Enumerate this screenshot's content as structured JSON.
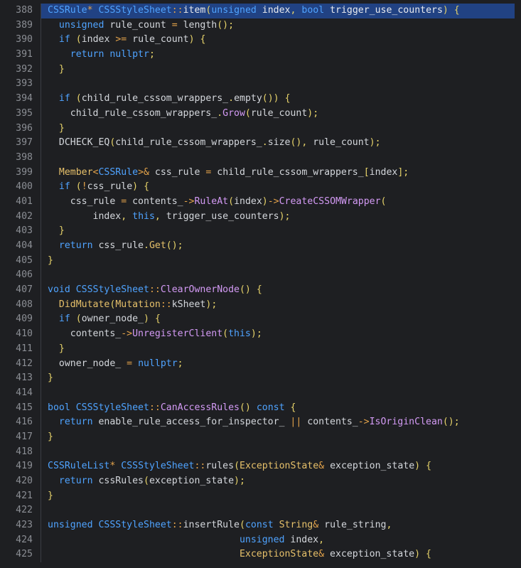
{
  "editor": {
    "lines": [
      {
        "n": "388",
        "html": "<span class='ty'>CSSRule</span><span class='op'>*</span> <span class='ty'>CSSStyleSheet</span><span class='op'>::</span>item<span class='pun'>(</span><span class='kw'>unsigned</span> index<span class='pun'>,</span> <span class='kw'>bool</span> trigger_use_counters<span class='pun'>)</span> <span class='pun'>{</span>"
      },
      {
        "n": "389",
        "html": "  <span class='kw'>unsigned</span> rule_count <span class='op'>=</span> length<span class='pun'>();</span>"
      },
      {
        "n": "390",
        "html": "  <span class='kw'>if</span> <span class='pun'>(</span>index <span class='op'>&gt;=</span> rule_count<span class='pun'>)</span> <span class='pun'>{</span>"
      },
      {
        "n": "391",
        "html": "    <span class='kw'>return</span> <span class='kw'>nullptr</span><span class='pun'>;</span>"
      },
      {
        "n": "392",
        "html": "  <span class='pun'>}</span>"
      },
      {
        "n": "393",
        "html": ""
      },
      {
        "n": "394",
        "html": "  <span class='kw'>if</span> <span class='pun'>(</span>child_rule_cssom_wrappers_<span class='pun'>.</span>empty<span class='pun'>())</span> <span class='pun'>{</span>"
      },
      {
        "n": "395",
        "html": "    child_rule_cssom_wrappers_<span class='pun'>.</span><span class='fn'>Grow</span><span class='pun'>(</span>rule_count<span class='pun'>);</span>"
      },
      {
        "n": "396",
        "html": "  <span class='pun'>}</span>"
      },
      {
        "n": "397",
        "html": "  DCHECK_EQ<span class='pun'>(</span>child_rule_cssom_wrappers_<span class='pun'>.</span>size<span class='pun'>(),</span> rule_count<span class='pun'>);</span>"
      },
      {
        "n": "398",
        "html": ""
      },
      {
        "n": "399",
        "html": "  <span class='mac'>Member</span><span class='op'>&lt;</span><span class='ty'>CSSRule</span><span class='op'>&gt;&amp;</span> css_rule <span class='op'>=</span> child_rule_cssom_wrappers_<span class='pun'>[</span>index<span class='pun'>];</span>"
      },
      {
        "n": "400",
        "html": "  <span class='kw'>if</span> <span class='pun'>(</span><span class='op'>!</span>css_rule<span class='pun'>)</span> <span class='pun'>{</span>"
      },
      {
        "n": "401",
        "html": "    css_rule <span class='op'>=</span> contents_<span class='op'>-&gt;</span><span class='fn'>RuleAt</span><span class='pun'>(</span>index<span class='pun'>)</span><span class='op'>-&gt;</span><span class='fn'>CreateCSSOMWrapper</span><span class='pun'>(</span>"
      },
      {
        "n": "402",
        "html": "        index<span class='pun'>,</span> <span class='kw'>this</span><span class='pun'>,</span> trigger_use_counters<span class='pun'>);</span>"
      },
      {
        "n": "403",
        "html": "  <span class='pun'>}</span>"
      },
      {
        "n": "404",
        "html": "  <span class='kw'>return</span> css_rule<span class='pun'>.</span><span class='mac'>Get</span><span class='pun'>();</span>"
      },
      {
        "n": "405",
        "html": "<span class='pun'>}</span>"
      },
      {
        "n": "406",
        "html": ""
      },
      {
        "n": "407",
        "html": "<span class='kw'>void</span> <span class='ty'>CSSStyleSheet</span><span class='op'>::</span><span class='fn'>ClearOwnerNode</span><span class='pun'>()</span> <span class='pun'>{</span>"
      },
      {
        "n": "408",
        "html": "  <span class='mac'>DidMutate</span><span class='pun'>(</span><span class='mac'>Mutation</span><span class='op'>::</span>kSheet<span class='pun'>);</span>"
      },
      {
        "n": "409",
        "html": "  <span class='kw'>if</span> <span class='pun'>(</span>owner_node_<span class='pun'>)</span> <span class='pun'>{</span>"
      },
      {
        "n": "410",
        "html": "    contents_<span class='op'>-&gt;</span><span class='fn'>UnregisterClient</span><span class='pun'>(</span><span class='kw'>this</span><span class='pun'>);</span>"
      },
      {
        "n": "411",
        "html": "  <span class='pun'>}</span>"
      },
      {
        "n": "412",
        "html": "  owner_node_ <span class='op'>=</span> <span class='kw'>nullptr</span><span class='pun'>;</span>"
      },
      {
        "n": "413",
        "html": "<span class='pun'>}</span>"
      },
      {
        "n": "414",
        "html": ""
      },
      {
        "n": "415",
        "html": "<span class='kw'>bool</span> <span class='ty'>CSSStyleSheet</span><span class='op'>::</span><span class='fn'>CanAccessRules</span><span class='pun'>()</span> <span class='kw'>const</span> <span class='pun'>{</span>"
      },
      {
        "n": "416",
        "html": "  <span class='kw'>return</span> enable_rule_access_for_inspector_ <span class='op'>||</span> contents_<span class='op'>-&gt;</span><span class='fn'>IsOriginClean</span><span class='pun'>();</span>"
      },
      {
        "n": "417",
        "html": "<span class='pun'>}</span>"
      },
      {
        "n": "418",
        "html": ""
      },
      {
        "n": "419",
        "html": "<span class='ty'>CSSRuleList</span><span class='op'>*</span> <span class='ty'>CSSStyleSheet</span><span class='op'>::</span>rules<span class='pun'>(</span><span class='mac'>ExceptionState</span><span class='op'>&amp;</span> exception_state<span class='pun'>)</span> <span class='pun'>{</span>"
      },
      {
        "n": "420",
        "html": "  <span class='kw'>return</span> cssRules<span class='pun'>(</span>exception_state<span class='pun'>);</span>"
      },
      {
        "n": "421",
        "html": "<span class='pun'>}</span>"
      },
      {
        "n": "422",
        "html": ""
      },
      {
        "n": "423",
        "html": "<span class='kw'>unsigned</span> <span class='ty'>CSSStyleSheet</span><span class='op'>::</span>insertRule<span class='pun'>(</span><span class='kw'>const</span> <span class='mac'>String</span><span class='op'>&amp;</span> rule_string<span class='pun'>,</span>"
      },
      {
        "n": "424",
        "html": "                                  <span class='kw'>unsigned</span> index<span class='pun'>,</span>"
      },
      {
        "n": "425",
        "html": "                                  <span class='mac'>ExceptionState</span><span class='op'>&amp;</span> exception_state<span class='pun'>)</span> <span class='pun'>{</span>"
      }
    ]
  }
}
